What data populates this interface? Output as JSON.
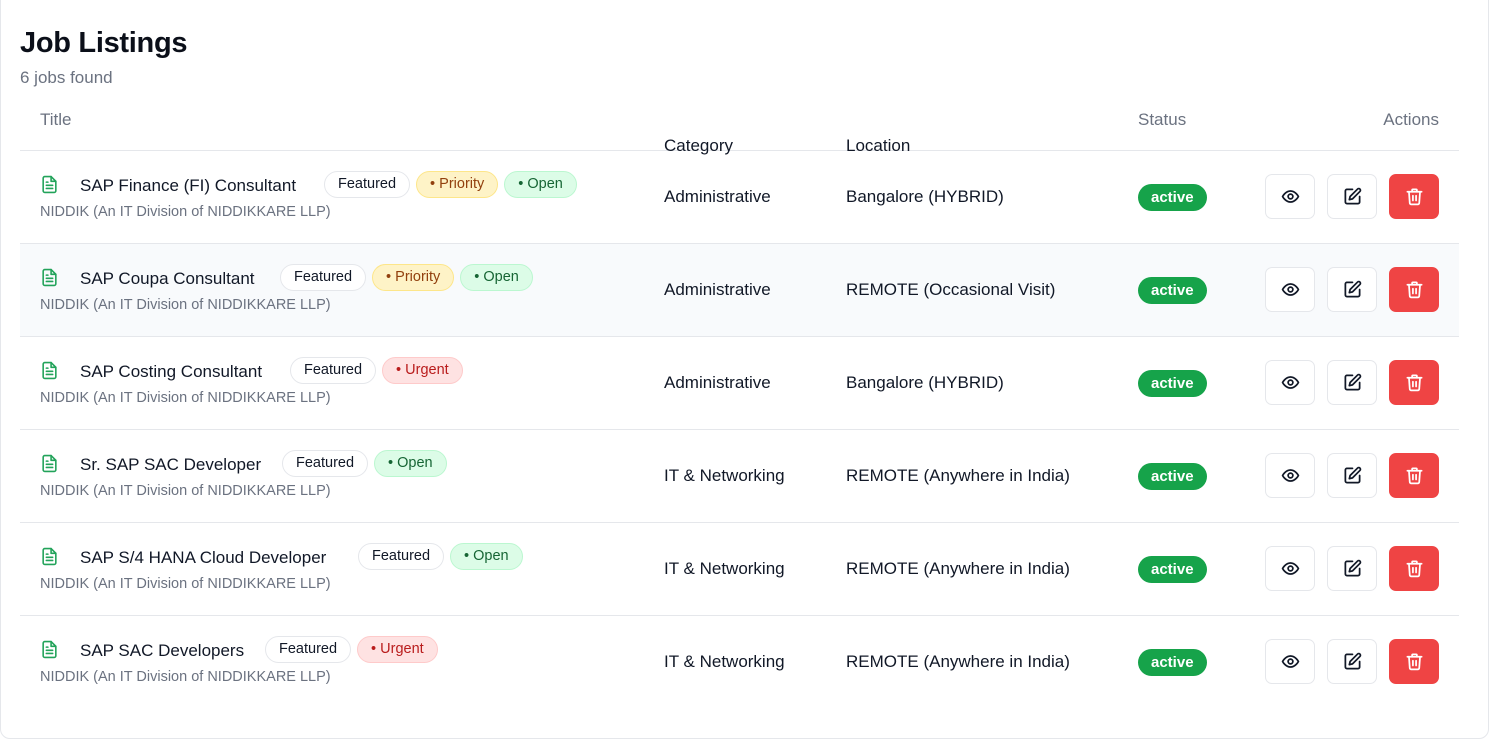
{
  "header": {
    "title": "Job Listings",
    "subtitle": "6 jobs found"
  },
  "table": {
    "columns": {
      "title": "Title",
      "category": "Category",
      "location": "Location",
      "status": "Status",
      "actions": "Actions"
    },
    "rows": [
      {
        "title": "SAP Finance (FI) Consultant",
        "badges": [
          "Featured",
          "• Priority",
          "• Open"
        ],
        "company": "NIDDIK (An IT Division of NIDDIKKARE LLP)",
        "category": "Administrative",
        "location": "Bangalore (HYBRID)",
        "status": "active"
      },
      {
        "title": "SAP Coupa Consultant",
        "badges": [
          "Featured",
          "• Priority",
          "• Open"
        ],
        "company": "NIDDIK (An IT Division of NIDDIKKARE LLP)",
        "category": "Administrative",
        "location": "REMOTE (Occasional Visit)",
        "status": "active"
      },
      {
        "title": "SAP Costing Consultant",
        "badges": [
          "Featured",
          "• Urgent"
        ],
        "company": "NIDDIK (An IT Division of NIDDIKKARE LLP)",
        "category": "Administrative",
        "location": "Bangalore (HYBRID)",
        "status": "active"
      },
      {
        "title": "Sr. SAP SAC Developer",
        "badges": [
          "Featured",
          "• Open"
        ],
        "company": "NIDDIK (An IT Division of NIDDIKKARE LLP)",
        "category": "IT & Networking",
        "location": "REMOTE (Anywhere in India)",
        "status": "active"
      },
      {
        "title": "SAP S/4 HANA Cloud Developer",
        "badges": [
          "Featured",
          "• Open"
        ],
        "company": "NIDDIK (An IT Division of NIDDIKKARE LLP)",
        "category": "IT & Networking",
        "location": "REMOTE (Anywhere in India)",
        "status": "active"
      },
      {
        "title": "SAP SAC Developers",
        "badges": [
          "Featured",
          "• Urgent"
        ],
        "company": "NIDDIK (An IT Division of NIDDIKKARE LLP)",
        "category": "IT & Networking",
        "location": "REMOTE (Anywhere in India)",
        "status": "active"
      }
    ]
  },
  "icons": {
    "row": "document-icon",
    "view": "eye-icon",
    "edit": "edit-icon",
    "delete": "trash-icon"
  },
  "colors": {
    "status_active": "#16a34a",
    "delete_button": "#ef4444",
    "document_icon": "#22a35a"
  }
}
